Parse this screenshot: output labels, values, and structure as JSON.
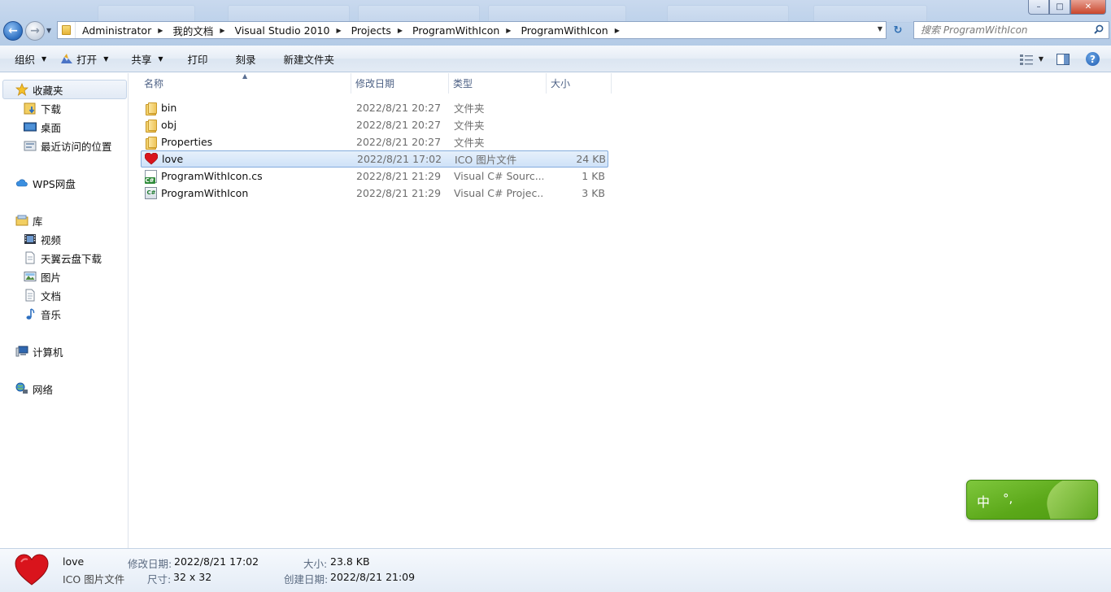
{
  "window": {
    "controls": {
      "minimize": "–",
      "maximize": "□",
      "close": "✕"
    }
  },
  "nav": {
    "back_glyph": "←",
    "forward_glyph": "→",
    "history_dropdown_glyph": "▼"
  },
  "address": {
    "crumbs": [
      "Administrator",
      "我的文档",
      "Visual Studio 2010",
      "Projects",
      "ProgramWithIcon",
      "ProgramWithIcon"
    ],
    "separator_glyph": "▶",
    "dropdown_glyph": "▼",
    "refresh_glyph": "↻"
  },
  "search": {
    "placeholder": "搜索 ProgramWithIcon"
  },
  "toolbar": {
    "organize": "组织",
    "open": "打开",
    "share": "共享",
    "print": "打印",
    "burn": "刻录",
    "new_folder": "新建文件夹",
    "dropdown_glyph": "▼",
    "help_glyph": "?"
  },
  "sidebar": {
    "favorites": {
      "label": "收藏夹",
      "items": [
        "下载",
        "桌面",
        "最近访问的位置"
      ]
    },
    "wps": "WPS网盘",
    "libraries": {
      "label": "库",
      "items": [
        "视频",
        "天翼云盘下载",
        "图片",
        "文档",
        "音乐"
      ]
    },
    "computer": "计算机",
    "network": "网络"
  },
  "columns": {
    "name": "名称",
    "modified": "修改日期",
    "type": "类型",
    "size": "大小",
    "sort_glyph": "▲"
  },
  "files": [
    {
      "name": "bin",
      "modified": "2022/8/21 20:27",
      "type": "文件夹",
      "size": "",
      "icon": "folder-icon"
    },
    {
      "name": "obj",
      "modified": "2022/8/21 20:27",
      "type": "文件夹",
      "size": "",
      "icon": "folder-icon"
    },
    {
      "name": "Properties",
      "modified": "2022/8/21 20:27",
      "type": "文件夹",
      "size": "",
      "icon": "folder-icon"
    },
    {
      "name": "love",
      "modified": "2022/8/21 17:02",
      "type": "ICO 图片文件",
      "size": "24 KB",
      "icon": "heart-icon",
      "selected": true
    },
    {
      "name": "ProgramWithIcon.cs",
      "modified": "2022/8/21 21:29",
      "type": "Visual C# Sourc...",
      "size": "1 KB",
      "icon": "csharp-file-icon"
    },
    {
      "name": "ProgramWithIcon",
      "modified": "2022/8/21 21:29",
      "type": "Visual C# Projec...",
      "size": "3 KB",
      "icon": "csharp-project-icon"
    }
  ],
  "ime": {
    "lang": "中",
    "punct": "°,"
  },
  "details": {
    "name": "love",
    "type": "ICO 图片文件",
    "modified_label": "修改日期:",
    "modified_value": "2022/8/21 17:02",
    "size_label": "大小:",
    "size_value": "23.8 KB",
    "dimensions_label": "尺寸:",
    "dimensions_value": "32 x 32",
    "created_label": "创建日期:",
    "created_value": "2022/8/21 21:09"
  },
  "colors": {
    "accent": "#3a78c9",
    "selection_border": "#84acdd",
    "selection_fill": "#d9e8f9",
    "heart": "#d9141c",
    "ime_green": "#5ba819"
  }
}
